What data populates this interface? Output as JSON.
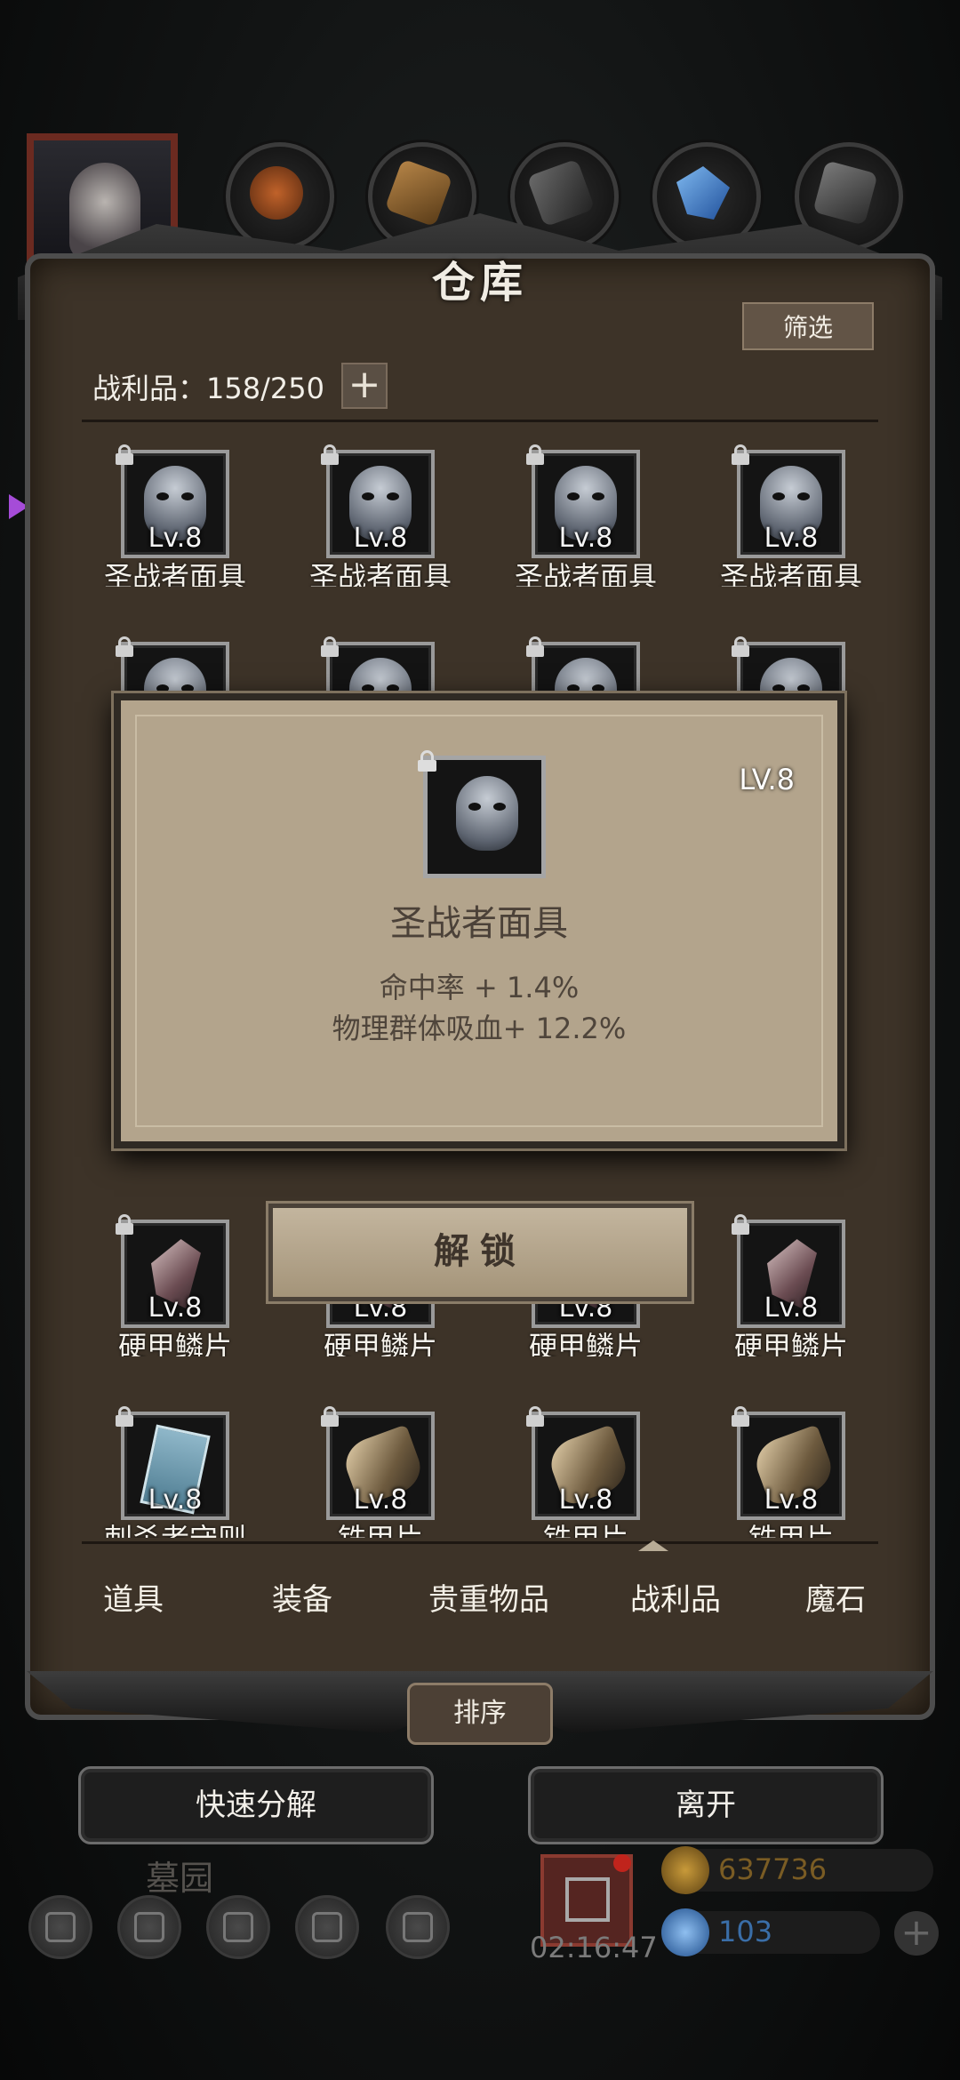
{
  "header": {
    "title": "仓库",
    "filter_label": "筛选"
  },
  "inventory": {
    "count_text": "战利品：158/250",
    "add_label": "+"
  },
  "grid": {
    "row1": [
      {
        "level": "Lv.8",
        "name": "圣战者面具",
        "icon": "mask-icon"
      },
      {
        "level": "Lv.8",
        "name": "圣战者面具",
        "icon": "mask-icon"
      },
      {
        "level": "Lv.8",
        "name": "圣战者面具",
        "icon": "mask-icon"
      },
      {
        "level": "Lv.8",
        "name": "圣战者面具",
        "icon": "mask-icon"
      }
    ],
    "row5": [
      {
        "level": "Lv.8",
        "name": "硬甲鳞片",
        "icon": "scale-icon"
      },
      {
        "level": "Lv.8",
        "name": "硬甲鳞片",
        "icon": "scale-icon"
      },
      {
        "level": "Lv.8",
        "name": "硬甲鳞片",
        "icon": "scale-icon"
      },
      {
        "level": "Lv.8",
        "name": "硬甲鳞片",
        "icon": "scale-icon"
      }
    ],
    "row6": [
      {
        "level": "Lv.8",
        "name": "刺杀者守则",
        "icon": "book-icon"
      },
      {
        "level": "Lv.8",
        "name": "铁甲片",
        "icon": "gauntlet-icon"
      },
      {
        "level": "Lv.8",
        "name": "铁甲片",
        "icon": "gauntlet-icon"
      },
      {
        "level": "Lv.8",
        "name": "铁甲片",
        "icon": "gauntlet-icon"
      }
    ]
  },
  "popup": {
    "level": "LV.8",
    "name": "圣战者面具",
    "attrs": [
      "命中率 + 1.4%",
      "物理群体吸血+ 12.2%"
    ],
    "unlock_label": "解锁"
  },
  "tabs": [
    {
      "label": "道具",
      "active": false
    },
    {
      "label": "装备",
      "active": false
    },
    {
      "label": "贵重物品",
      "active": false
    },
    {
      "label": "战利品",
      "active": true
    },
    {
      "label": "魔石",
      "active": false
    }
  ],
  "actions": {
    "sort_label": "排序",
    "quick_disassemble_label": "快速分解",
    "leave_label": "离开"
  },
  "hud": {
    "area_name": "墓园",
    "timer": "02:16:47",
    "gold": "637736",
    "gems": "103",
    "add_label": "+"
  },
  "colors": {
    "panel": "#3d3328",
    "popup": "#b3a48c",
    "gold": "#8a6a2c",
    "gems": "#3a6ea8",
    "notify": "#e0322b"
  }
}
